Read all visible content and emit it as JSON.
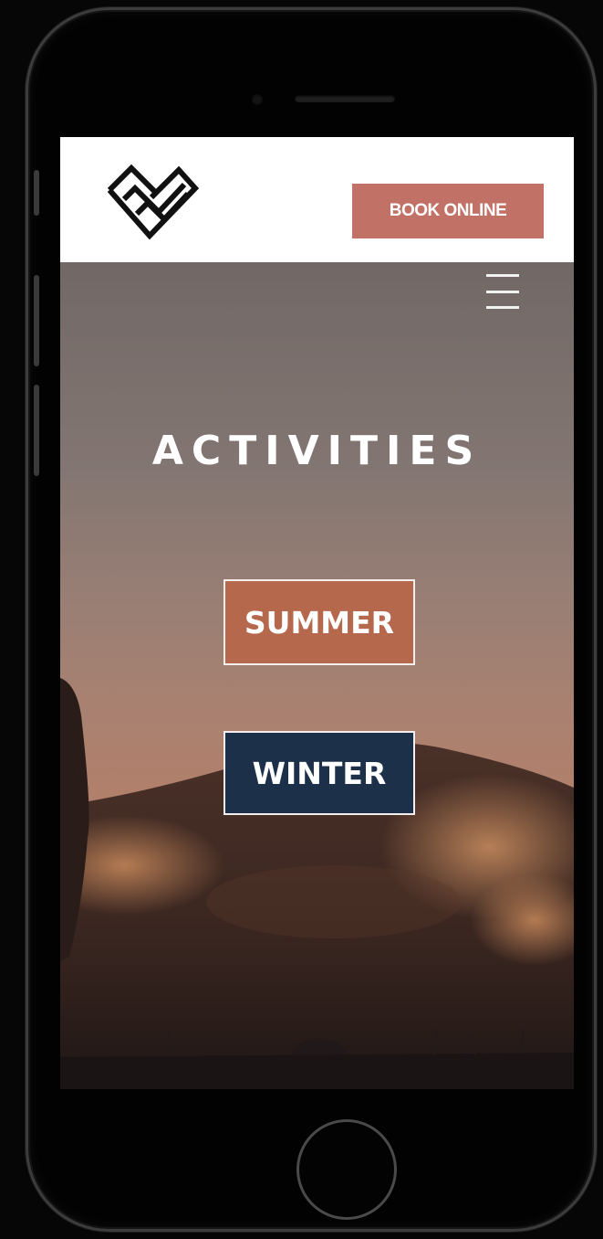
{
  "header": {
    "book_label": "BOOK ONLINE"
  },
  "hero": {
    "title": "ACTIVITIES",
    "buttons": {
      "summer": "SUMMER",
      "winter": "WINTER"
    }
  },
  "colors": {
    "book_button": "#c27166",
    "summer_button": "#b5684c",
    "winter_button": "#1c3049"
  },
  "icons": {
    "logo": "heart-chevron-logo",
    "menu": "hamburger-menu-icon"
  }
}
